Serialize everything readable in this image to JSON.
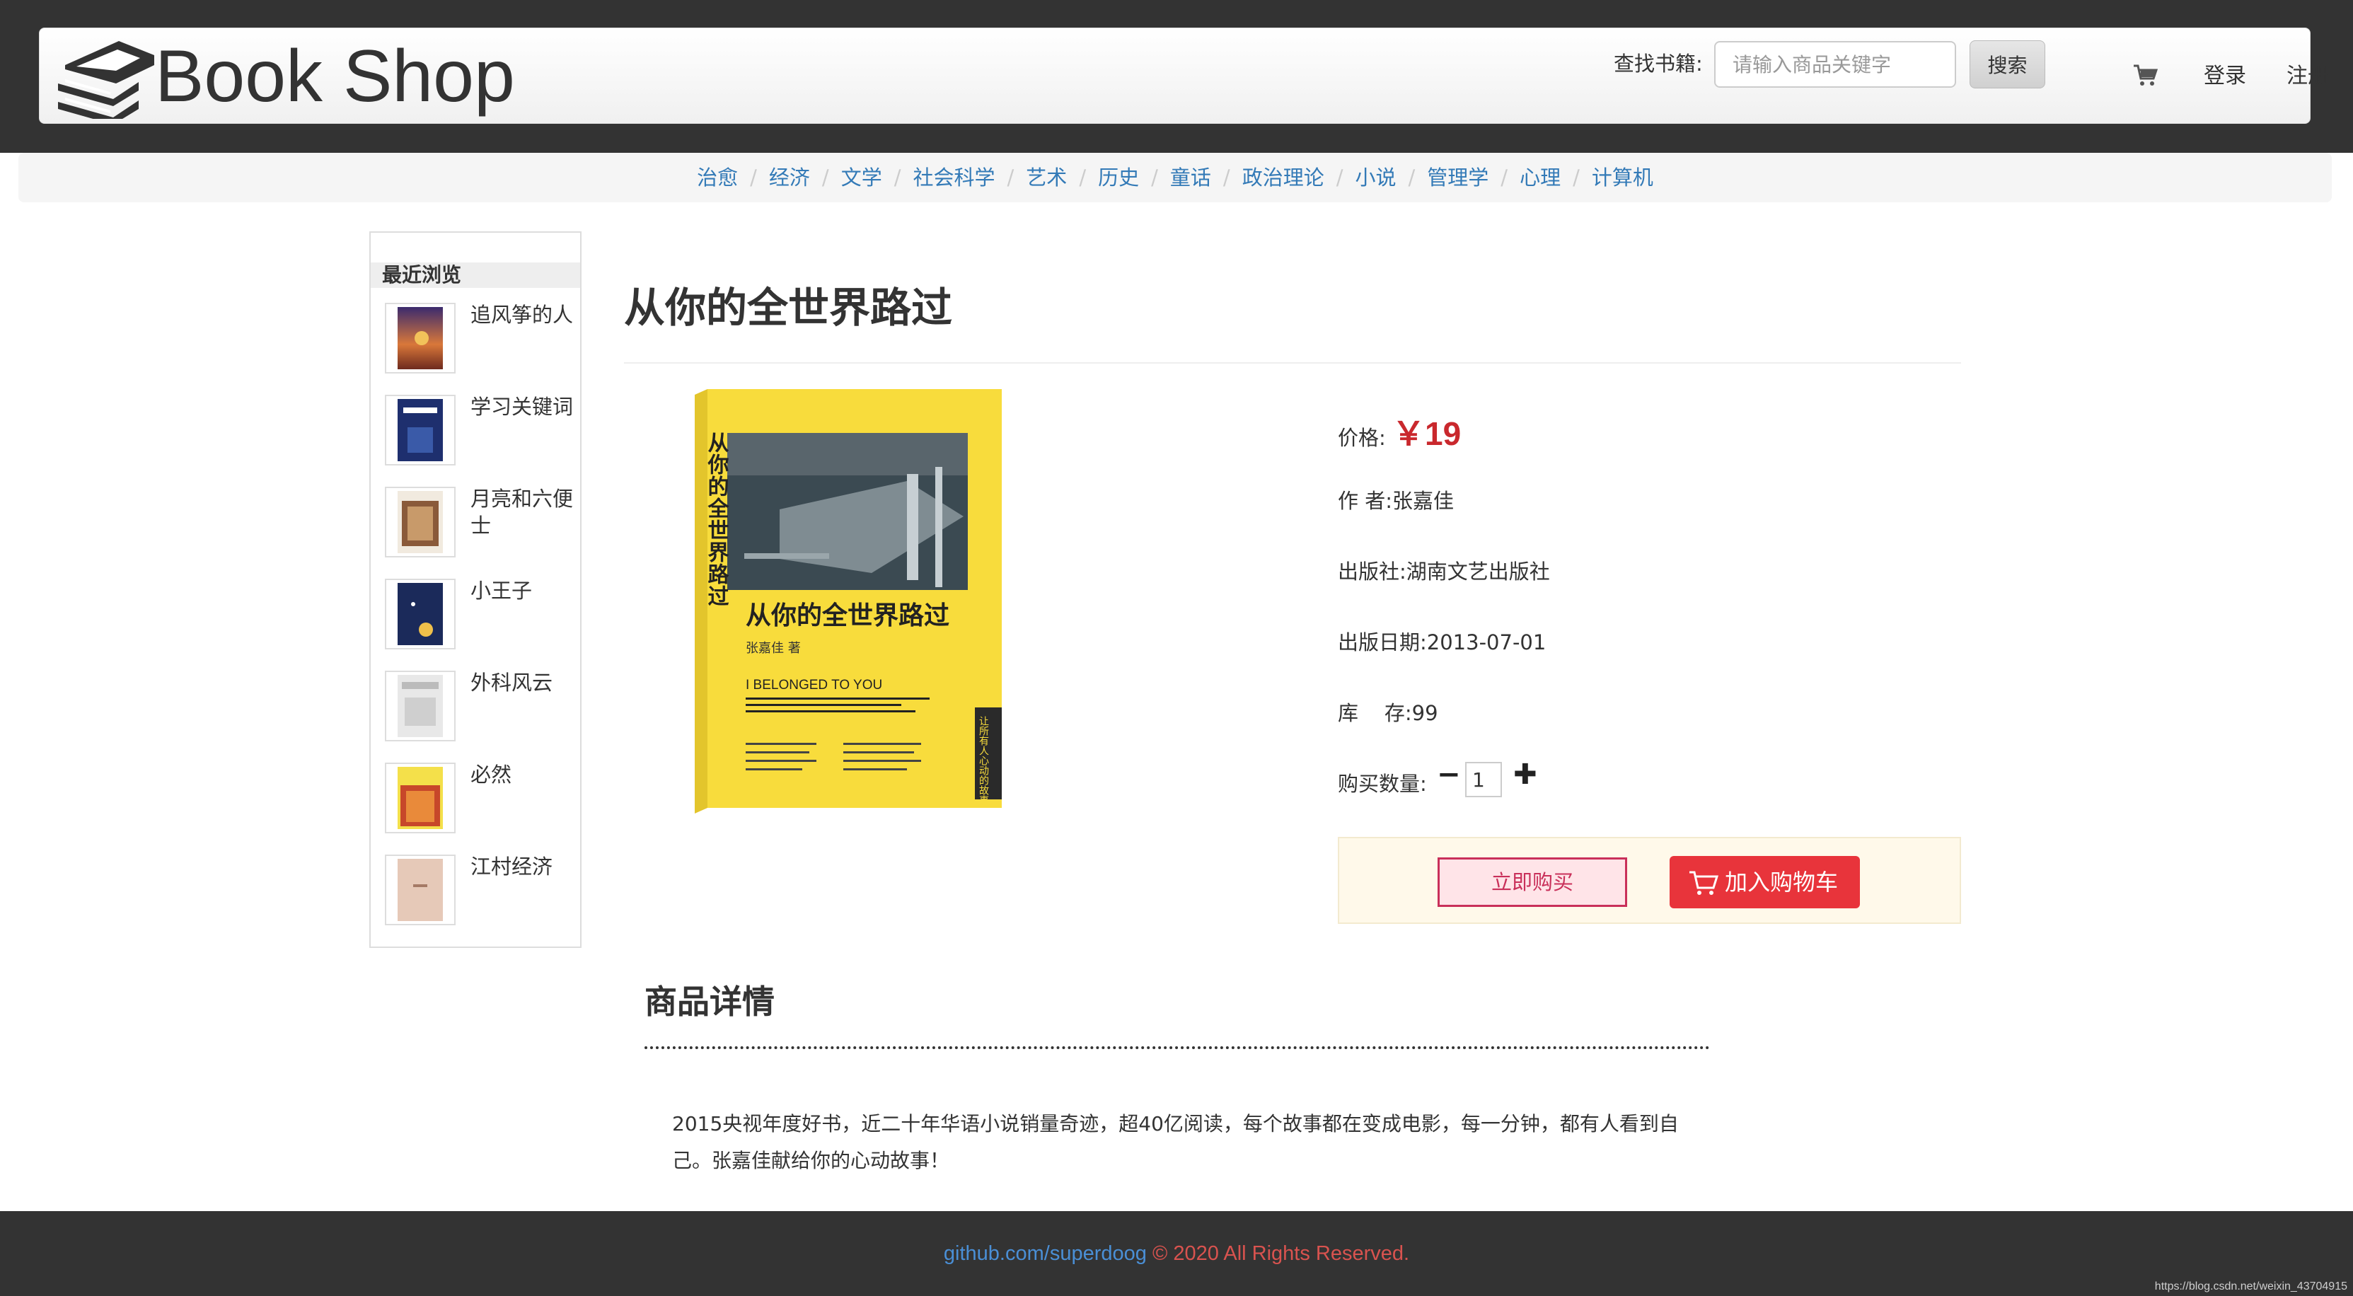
{
  "header": {
    "title": "Book Shop",
    "search_label": "查找书籍:",
    "search_placeholder": "请输入商品关键字",
    "search_button": "搜索",
    "login": "登录",
    "register": "注册"
  },
  "categories": [
    "治愈",
    "经济",
    "文学",
    "社会科学",
    "艺术",
    "历史",
    "童话",
    "政治理论",
    "小说",
    "管理学",
    "心理",
    "计算机"
  ],
  "sidebar": {
    "title": "最近浏览",
    "items": [
      "追风筝的人",
      "学习关键词",
      "月亮和六便士",
      "小王子",
      "外科风云",
      "必然",
      "江村经济"
    ]
  },
  "product": {
    "title": "从你的全世界路过",
    "cover": {
      "title": "从你的全世界路过",
      "author": "张嘉佳 著",
      "english": "I BELONGED TO YOU",
      "side_text": "让所有人心动的故事"
    },
    "price_label": "价格:",
    "price": "￥19",
    "author_label": "作 者:",
    "author": "张嘉佳",
    "publisher_label": "出版社:",
    "publisher": "湖南文艺出版社",
    "date_label": "出版日期:",
    "date": "2013-07-01",
    "stock_label": "库    存:",
    "stock": "99",
    "qty_label": "购买数量:",
    "qty": "1",
    "buy_now": "立即购买",
    "add_to_cart": "加入购物车"
  },
  "details": {
    "heading": "商品详情",
    "text": "2015央视年度好书，近二十年华语小说销量奇迹，超40亿阅读，每个故事都在变成电影，每一分钟，都有人看到自己。张嘉佳献给你的心动故事！"
  },
  "footer": {
    "link": "github.com/superdoog",
    "copy": " © 2020 All Rights Reserved.",
    "watermark": "https://blog.csdn.net/weixin_43704915"
  },
  "colors": {
    "header_bg": "#333333",
    "link": "#337ab7",
    "price": "#c9282d",
    "add_cart_bg": "#e8343b",
    "buy_now_border": "#c9305a"
  },
  "icons": [
    "books-logo-icon",
    "cart-icon",
    "minus-icon",
    "plus-icon",
    "cart-glyph-icon"
  ]
}
